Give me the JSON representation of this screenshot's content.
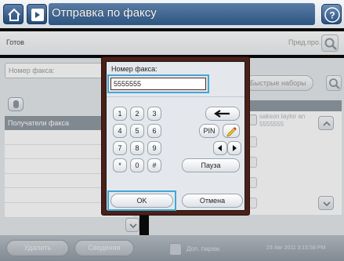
{
  "titlebar": {
    "title": "Отправка по факсу"
  },
  "statusbar": {
    "status": "Готов",
    "preview_label": "Пред.про."
  },
  "left_panel": {
    "fax_number_placeholder": "Номер факса:",
    "recipients_header": "Получатели факса"
  },
  "right_panel": {
    "quick_dials_label": "Быстрые наборы",
    "contact": {
      "name": "sakson taylor an",
      "number": "5555555"
    }
  },
  "dialog": {
    "label": "Номер факса:",
    "input_value": "5555555",
    "keys": [
      "1",
      "2",
      "3",
      "4",
      "5",
      "6",
      "7",
      "8",
      "9",
      "*",
      "0",
      "#"
    ],
    "pin_label": "PIN",
    "pause_label": "Пауза",
    "ok_label": "OK",
    "cancel_label": "Отмена"
  },
  "bottombar": {
    "delete_label": "Удалить",
    "details_label": "Сведения",
    "options_label": "Доп. парам.",
    "timestamp": "23 Авг 2011 3:15:58 PM"
  },
  "icons": {
    "home": "home-icon",
    "fax": "fax-icon",
    "help": "help-icon",
    "search": "search-icon",
    "backspace": "backspace-icon",
    "edit": "pencil-icon",
    "left": "arrow-left-icon",
    "right": "arrow-right-icon",
    "up": "chevron-up-icon",
    "down": "chevron-down-icon"
  },
  "colors": {
    "accent_blue": "#3fa7d6",
    "title_blue": "#2c5581",
    "dialog_frame": "#4a2019"
  }
}
